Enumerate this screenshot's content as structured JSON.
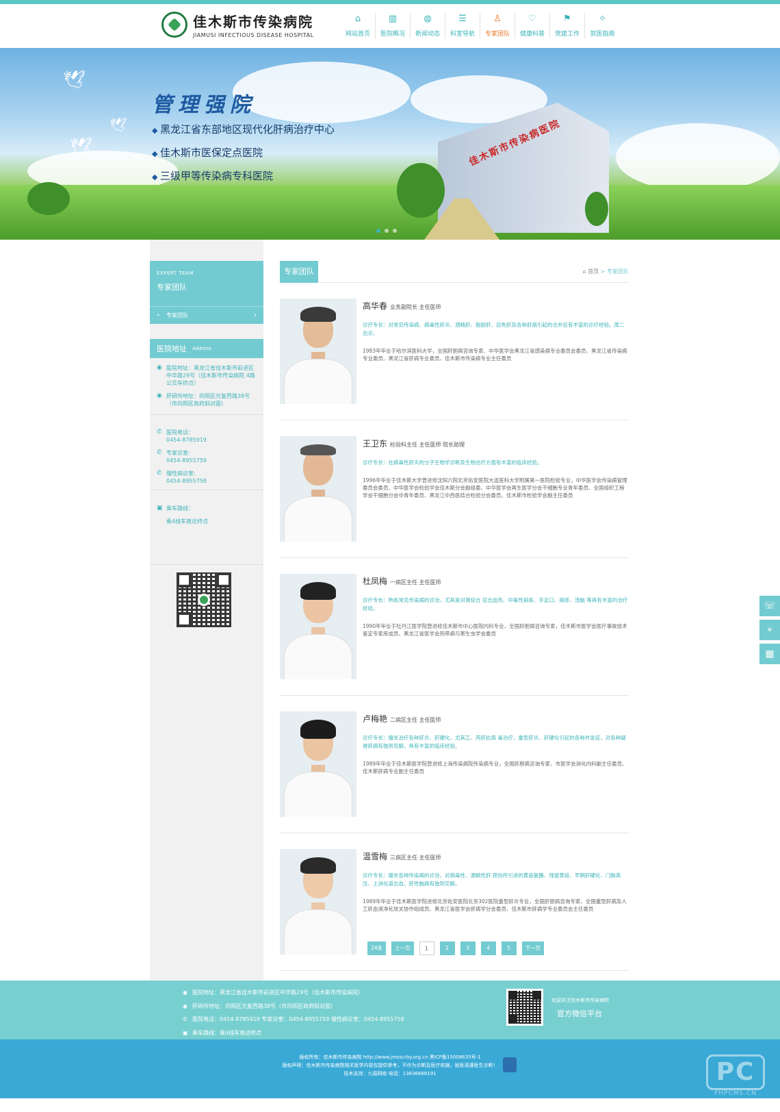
{
  "header": {
    "logo_cn": "佳木斯市传染病院",
    "logo_en": "JIAMUSI INFECTIOUS DISEASE HOSPITAL",
    "nav": [
      {
        "label": "网站首页",
        "icon": "home-icon",
        "glyph": "⌂"
      },
      {
        "label": "医院概况",
        "icon": "chart-icon",
        "glyph": "▥"
      },
      {
        "label": "新闻动态",
        "icon": "globe-icon",
        "glyph": "◍"
      },
      {
        "label": "科室导航",
        "icon": "list-icon",
        "glyph": "☰"
      },
      {
        "label": "专家团队",
        "icon": "user-icon",
        "glyph": "♙"
      },
      {
        "label": "健康科普",
        "icon": "heart-icon",
        "glyph": "♡"
      },
      {
        "label": "党建工作",
        "icon": "flag-icon",
        "glyph": "⚑"
      },
      {
        "label": "就医指南",
        "icon": "compass-icon",
        "glyph": "✧"
      }
    ]
  },
  "banner": {
    "slogan": "管理强院",
    "points": [
      "黑龙江省东部地区现代化肝病治疗中心",
      "佳木斯市医保定点医院",
      "三级甲等传染病专科医院"
    ],
    "building_sign": "佳木斯市传染病医院"
  },
  "sidebar": {
    "head_en": "EXPERT TEAM",
    "head_cn": "专家团队",
    "sub_item": "专家团队",
    "address_title": "医院地址",
    "address_en": "Address",
    "hospital_addr": "医院地址：黑龙江省佳木斯市前进区中华路29号（佳木斯市传染病院 4路公交车终点）",
    "liver_addr": "肝研所地址：向阳区光复西路38号（市向阳区政府斜对面）",
    "phone_label": "医院电话：",
    "phone": "0454-8785919",
    "expert_label": "专家诊室:",
    "expert_phone": "0454-8955759",
    "chronic_label": "慢性病诊室:",
    "chronic_phone": "0454-8955758",
    "bus_label": "乘车路线：",
    "bus_route": "乘4线车直达终点"
  },
  "main": {
    "title": "专家团队",
    "crumb_home": "首页",
    "crumb_sep": ">",
    "crumb_current": "专家团队",
    "doctors": [
      {
        "name": "高华春",
        "title": "业务副院长 主任医师",
        "spec": "诊疗专长：对常见传染病、病毒性肝炎、酒精肝、脂肪肝、自免肝及各种肝病引起的合并症有丰富的诊疗经验。周二出诊。",
        "bio": "1983年毕业于哈尔滨医科大学，全国肝胆病咨询专家、中华医学会黑龙江省感染病专业委员会委员、黑龙江省传染病专业委员、黑龙江省肝病专业委员、佳木斯市传染病专业主任委员"
      },
      {
        "name": "王卫东",
        "title": "检验科主任 主任医师 院长助理",
        "spec": "诊疗专长：在病毒性肝炎的分子生物学诊断及生物治疗方面有丰富的临床经验。",
        "bio": "1996年毕业于佳木斯大学曾进修沈阳六院北京佑安医院大连医科大学附属第一医院检验专业，中华医学会传染病管理委员会委员、中华医学会检验学会佳木斯分会副组委、中华医学会再生医学分会干细胞专业青年委员、全国组织工程学会干细胞分会中青年委员、黑龙江中西医结合检验分会委员、佳木斯市检验学会副主任委员"
      },
      {
        "name": "杜凤梅",
        "title": "一病区主任 主任医师",
        "spec": "诊疗专长：熟练常见传染病的诊治，尤其是对肾综合 征出血热、中毒性痢疾、手足口、麻疹、流脑 等具有丰富的治疗经验。",
        "bio": "1990年毕业于牡丹江医学院曾进修佳木斯市中心医院内科专业，全国肝胆病咨询专家，佳木斯市医学会医疗事故技术鉴定专家库成员、黑龙江省医学会热带病与寄生虫学会委员"
      },
      {
        "name": "卢梅艳",
        "title": "二病区主任 主任医师",
        "spec": "诊疗专长：擅长治疗各种肝炎、肝硬化，尤其乙、丙肝抗病 毒治疗，重型肝炎、肝硬化引起的各种并发症，对各种疑难肝病有独到见解，具有丰富的临床经验。",
        "bio": "1989年毕业于佳木斯医学院曾进修上海传染病院传染病专业，全国肝胆病咨询专家、市医学会消化内科副主任委员、佳木斯肝病专业副主任委员"
      },
      {
        "name": "温雪梅",
        "title": "三病区主任 主任医师",
        "spec": "诊疗专长：擅长各种传染病的诊治，对病毒性、酒精性肝 损伤所引进的黄疸氨酶、残留黄疸、早期肝硬化、门脉高压、上消化道出血、肝性脑病有独到见解。",
        "bio": "1989年毕业于佳木斯医学院进修北京佑安医院北京302医院重型肝炎专业，全国肝胆病咨询专家、全国重型肝病及人工肝血液净化攻关协作组成员、黑龙江省医学会肝病学分会委员、佳木斯市肝病学专业委员会主任委员"
      }
    ],
    "pager": [
      "24条",
      "上一页",
      "1",
      "2",
      "3",
      "4",
      "5",
      "下一页"
    ]
  },
  "footer": {
    "rows": [
      "医院地址：黑龙江省佳木斯市前进区中华路29号（佳木斯市传染病院）",
      "肝研所地址：向阳区光复西路38号（市向阳区政府斜对面）",
      "医院电话：0454-8785919   专家诊室：0454-8955759   慢性病诊室：0454-8955758",
      "乘车路线：乘4线车直达终点"
    ],
    "wechat_welcome": "欢迎关注佳木斯市传染病院",
    "wechat_platform": "官方微信平台",
    "copy1": "版权所有：佳木斯市传染病院 http://www.jmsscrby.org.cn 黑ICP备15008635号-1",
    "copy2": "版权声明：佳木斯市传染病院相关医学内容仅提供参考，不作为诊断及医疗依据，就医请遵医生诊断！",
    "copy3": "技术支持：九福网络 电话：13836668191",
    "watermark": "PHPCMS.CN"
  },
  "colors": {
    "accent": "#72cbd0",
    "active": "#e8792b",
    "footer_bottom": "#3aa9d6"
  }
}
